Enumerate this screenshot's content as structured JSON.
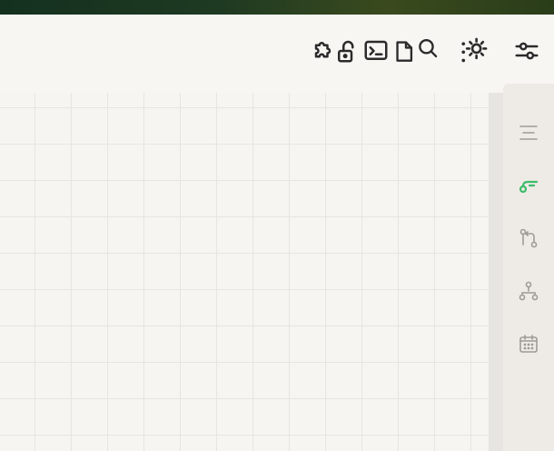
{
  "toolbar": {
    "icons": [
      {
        "name": "puzzle-icon"
      },
      {
        "name": "unlock-icon"
      },
      {
        "name": "terminal-icon"
      },
      {
        "name": "file-search-icon"
      },
      {
        "name": "sun-dots-icon"
      },
      {
        "name": "sliders-icon"
      }
    ]
  },
  "right_sidebar": {
    "items": [
      {
        "name": "align-center-icon",
        "active": false
      },
      {
        "name": "key-branch-icon",
        "active": true
      },
      {
        "name": "git-pull-request-icon",
        "active": false
      },
      {
        "name": "network-icon",
        "active": false
      },
      {
        "name": "calendar-icon",
        "active": false
      }
    ],
    "active_color": "#3dbb6a",
    "inactive_color": "#9e9b96"
  },
  "colors": {
    "background": "#f8f6f3",
    "grid_line": "#e7e5e1",
    "icon": "#2b2b2b"
  }
}
